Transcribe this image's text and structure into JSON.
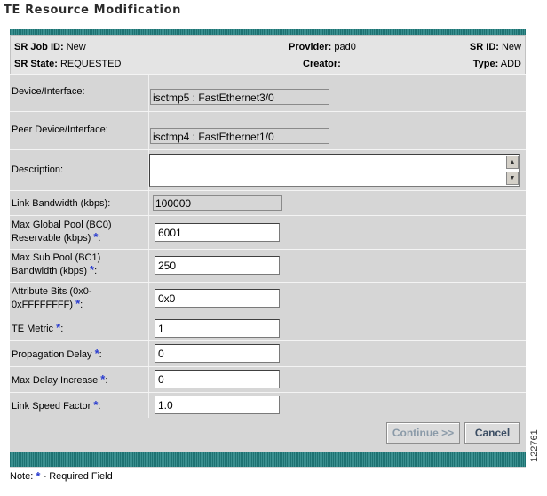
{
  "page": {
    "title": "TE Resource Modification",
    "image_id": "122761"
  },
  "header": {
    "sr_job_id_label": "SR Job ID:",
    "sr_job_id_value": "New",
    "provider_label": "Provider:",
    "provider_value": "pad0",
    "sr_id_label": "SR ID:",
    "sr_id_value": "New",
    "sr_state_label": "SR State:",
    "sr_state_value": "REQUESTED",
    "creator_label": "Creator:",
    "creator_value": "",
    "type_label": "Type:",
    "type_value": "ADD"
  },
  "form": {
    "device_interface": {
      "label": "Device/Interface:",
      "value": "isctmp5 : FastEthernet3/0"
    },
    "peer_device_interface": {
      "label": "Peer Device/Interface:",
      "value": "isctmp4 : FastEthernet1/0"
    },
    "description": {
      "label": "Description:",
      "value": ""
    },
    "link_bandwidth": {
      "label": "Link Bandwidth (kbps):",
      "value": "100000"
    },
    "max_global_pool": {
      "label_line1": "Max Global Pool (BC0)",
      "label_line2": "Reservable (kbps) ",
      "value": "6001"
    },
    "max_sub_pool": {
      "label_line1": "Max Sub Pool (BC1)",
      "label_line2": "Bandwidth (kbps) ",
      "value": "250"
    },
    "attribute_bits": {
      "label_line1": "Attribute Bits (0x0-",
      "label_line2": "0xFFFFFFFF) ",
      "value": "0x0"
    },
    "te_metric": {
      "label": "TE Metric ",
      "value": "1"
    },
    "propagation_delay": {
      "label": "Propagation Delay ",
      "value": "0"
    },
    "max_delay_increase": {
      "label": "Max Delay Increase ",
      "value": "0"
    },
    "link_speed_factor": {
      "label": "Link Speed Factor ",
      "value": "1.0"
    },
    "required_marker": "*",
    "colon": ":"
  },
  "buttons": {
    "continue_label": "Continue >>",
    "cancel_label": "Cancel"
  },
  "footer": {
    "note_prefix": "Note: ",
    "note_star": "*",
    "note_suffix": " - Required Field"
  },
  "colors": {
    "teal": "#1e7272",
    "panel_bg": "#d6d6d6",
    "required": "#2a3ccf"
  }
}
